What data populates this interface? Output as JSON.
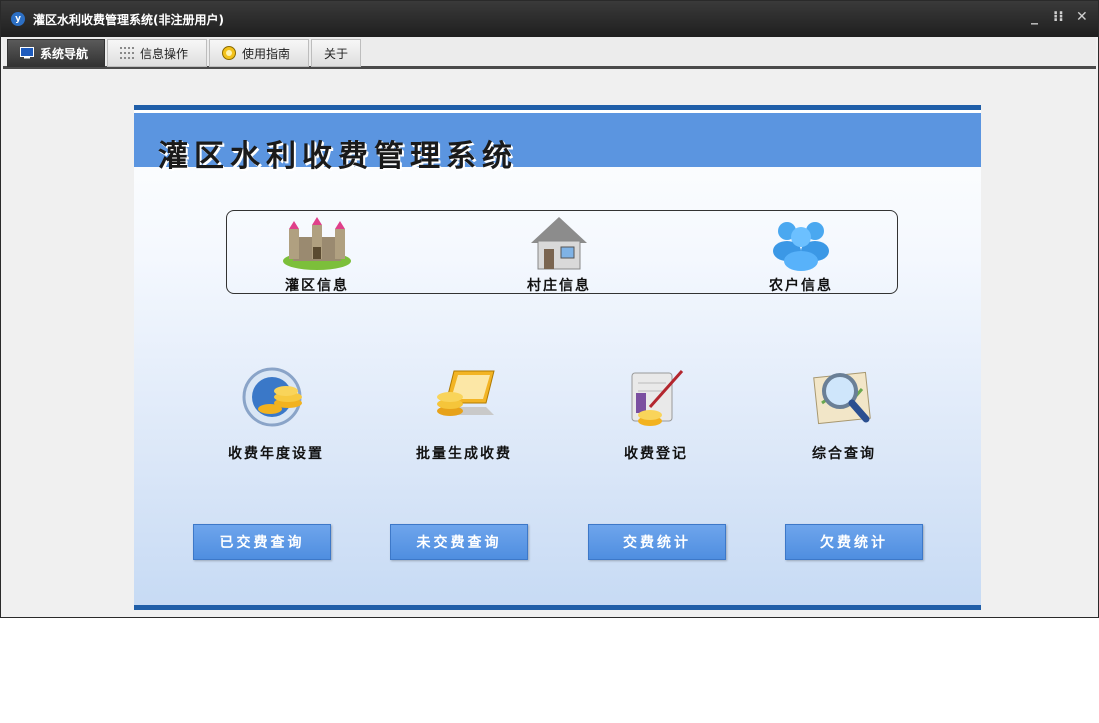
{
  "window": {
    "title": "灌区水利收费管理系统(非注册用户)",
    "app_icon_letter": "y",
    "controls": {
      "minimize": "_",
      "restore": "⁝⁝",
      "close": "✕"
    }
  },
  "tabs": [
    {
      "label": "系统导航",
      "icon": "monitor-icon",
      "active": true
    },
    {
      "label": "信息操作",
      "icon": "grid-icon",
      "active": false
    },
    {
      "label": "使用指南",
      "icon": "help-icon",
      "active": false
    },
    {
      "label": "关于",
      "icon": "",
      "active": false
    }
  ],
  "main": {
    "banner_title": "灌区水利收费管理系统",
    "info_items": [
      {
        "label": "灌区信息",
        "icon": "castle-icon"
      },
      {
        "label": "村庄信息",
        "icon": "house-icon"
      },
      {
        "label": "农户信息",
        "icon": "users-icon"
      }
    ],
    "function_items": [
      {
        "label": "收费年度设置",
        "icon": "coins-globe-icon"
      },
      {
        "label": "批量生成收费",
        "icon": "coins-laptop-icon"
      },
      {
        "label": "收费登记",
        "icon": "ledger-pen-icon"
      },
      {
        "label": "综合查询",
        "icon": "magnifier-map-icon"
      }
    ],
    "buttons": [
      {
        "label": "已交费查询"
      },
      {
        "label": "未交费查询"
      },
      {
        "label": "交费统计"
      },
      {
        "label": "欠费统计"
      }
    ]
  },
  "colors": {
    "banner": "#5b95e0",
    "accent_line": "#1f5ea8",
    "button": "#5b98e6",
    "titlebar": "#2a2a2a"
  }
}
